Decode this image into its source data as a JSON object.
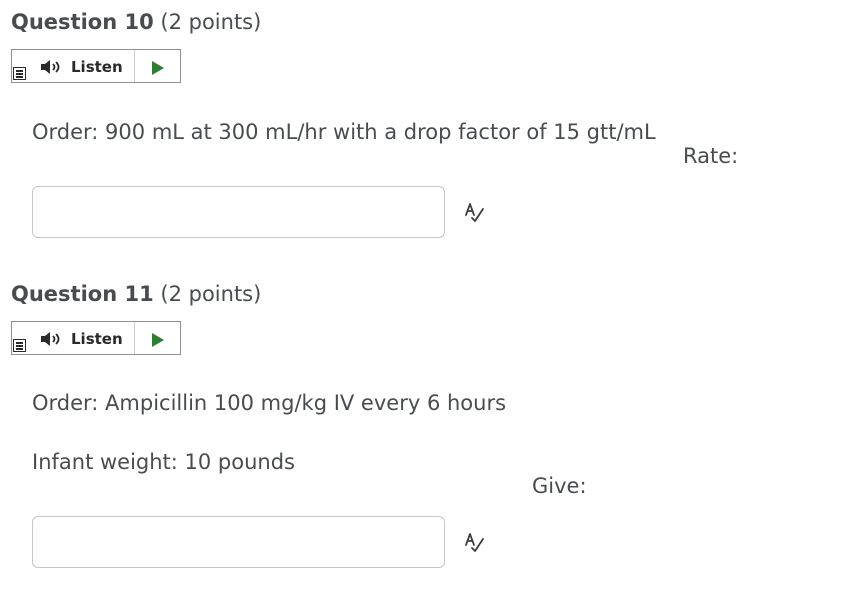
{
  "questions": [
    {
      "name": "Question 10",
      "points": "(2 points)",
      "listen_label": "Listen",
      "order_text": "Order: 900 mL at 300 mL/hr with a drop factor of 15 gtt/mL",
      "answer_label": "Rate:",
      "answer_value": "",
      "icons": {
        "menu": "menu-icon",
        "speaker": "speaker-icon",
        "play": "play-icon",
        "spell": "spell-check-icon"
      }
    },
    {
      "name": "Question 11",
      "points": "(2 points)",
      "listen_label": "Listen",
      "order_text": "Order: Ampicillin 100 mg/kg IV every 6 hours",
      "weight_text": "Infant weight: 10 pounds",
      "answer_label": "Give:",
      "answer_value": "",
      "icons": {
        "menu": "menu-icon",
        "speaker": "speaker-icon",
        "play": "play-icon",
        "spell": "spell-check-icon"
      }
    }
  ],
  "colors": {
    "text": "#494c4e",
    "play": "#2e7d32",
    "input_border": "#c6c6c6",
    "button_border": "#8f8f8f"
  }
}
